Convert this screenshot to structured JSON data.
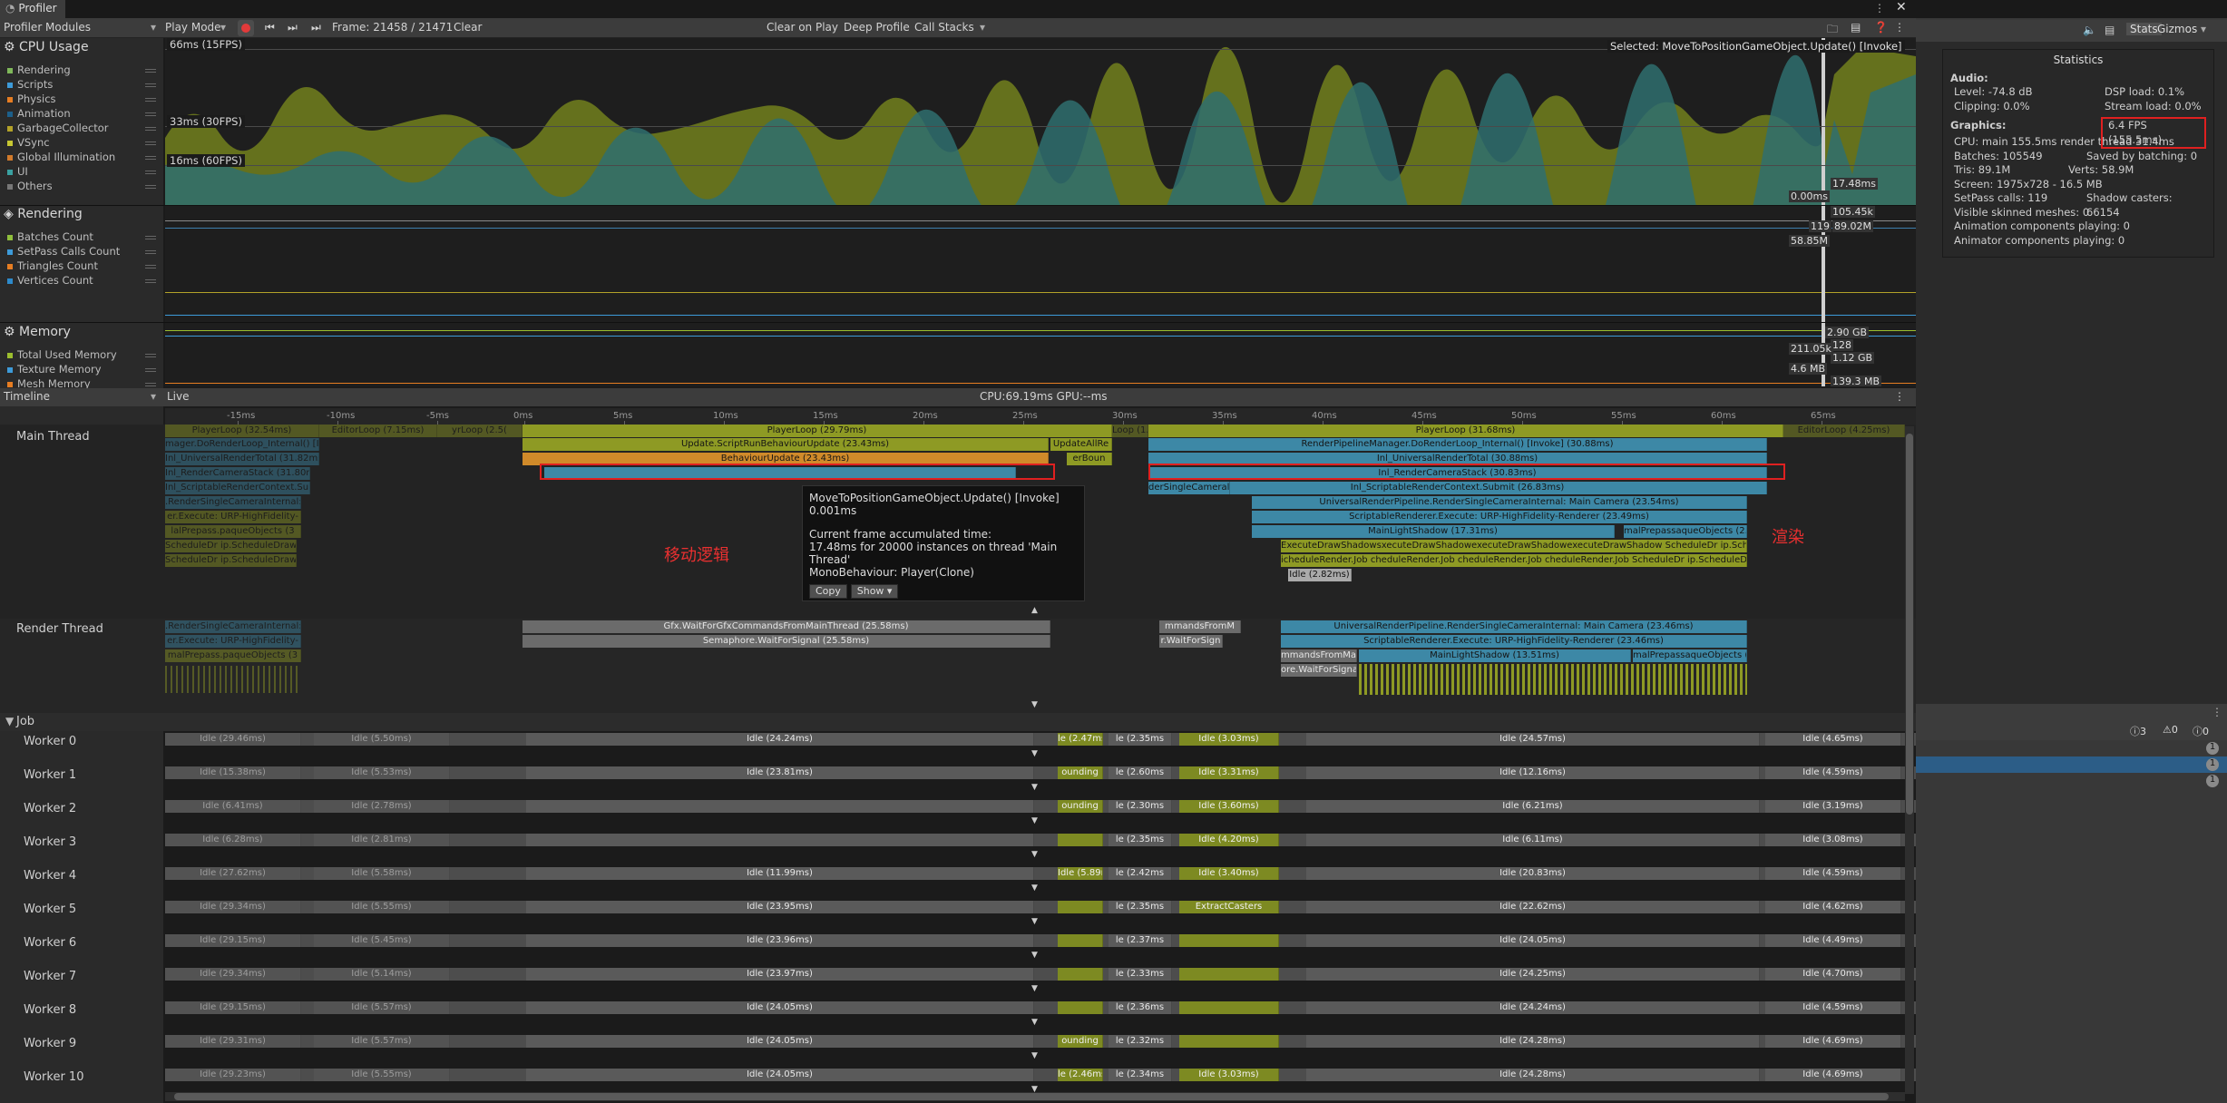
{
  "window": {
    "title": "Profiler"
  },
  "toolbar": {
    "modules": "Profiler Modules",
    "play_mode": "Play Mode",
    "frame": "Frame: 21458 / 21471",
    "clear": "Clear",
    "clear_on_play": "Clear on Play",
    "deep_profile": "Deep Profile",
    "call_stacks": "Call Stacks",
    "selected": "Selected: MoveToPositionGameObject.Update() [Invoke]"
  },
  "cpu": {
    "title": "CPU Usage",
    "items": [
      "Rendering",
      "Scripts",
      "Physics",
      "Animation",
      "GarbageCollector",
      "VSync",
      "Global Illumination",
      "UI",
      "Others"
    ],
    "colors": [
      "#7fb85a",
      "#3d9bd9",
      "#e67d22",
      "#1c5f8a",
      "#b3a229",
      "#c7c732",
      "#d17a2b",
      "#3aa1a1",
      "#777777"
    ],
    "fps": [
      "66ms (15FPS)",
      "33ms (30FPS)",
      "16ms (60FPS)"
    ]
  },
  "rendering": {
    "title": "Rendering",
    "items": [
      "Batches Count",
      "SetPass Calls Count",
      "Triangles Count",
      "Vertices Count"
    ],
    "colors": [
      "#8fbf3c",
      "#3d9bd9",
      "#e67d22",
      "#2d8acb"
    ]
  },
  "memory": {
    "title": "Memory",
    "items": [
      "Total Used Memory",
      "Texture Memory",
      "Mesh Memory"
    ],
    "colors": [
      "#9cbe2f",
      "#3d9bd9",
      "#e67d22"
    ]
  },
  "chart_labels": {
    "a": "0.00ms",
    "b": "17.48ms",
    "c": "105.45k",
    "d": "119",
    "e": "89.02M",
    "f": "58.85M",
    "g": "2.90 GB",
    "h": "128",
    "i": "211.05k",
    "j": "1.12 GB",
    "k": "4.6 MB",
    "l": "139.3 MB"
  },
  "timeline": {
    "label": "Timeline",
    "live": "Live",
    "cpu_gpu": "CPU:69.19ms  GPU:--ms",
    "ticks": [
      "-15ms",
      "-10ms",
      "-5ms",
      "0ms",
      "5ms",
      "10ms",
      "15ms",
      "20ms",
      "25ms",
      "30ms",
      "35ms",
      "40ms",
      "45ms",
      "50ms",
      "55ms",
      "60ms",
      "65ms"
    ]
  },
  "main_thread": {
    "label": "Main Thread",
    "bars": {
      "pl_left": "PlayerLoop (32.54ms)",
      "el_left": "EditorLoop (7.15ms)",
      "pl_left2": "yrLoop (2.5(",
      "r1": "mager.DoRenderLoop_Internal() [I",
      "r2": "Inl_UniversalRenderTotal (31.82ms",
      "r3": "Inl_RenderCameraStack (31.80ms)",
      "r4": "Inl_ScriptableRenderContext.Submit (28.",
      "r5": ".RenderSingleCameraInternal: M",
      "r6": "er.Execute: URP-HighFidelity-",
      "r7": "lalPrepass.paqueObjects (3",
      "r8": "ScheduleDr ip.ScheduleDraw",
      "r9": "ScheduleDr ip.ScheduleDraw",
      "pl": "PlayerLoop (29.79ms)",
      "upd": "Update.ScriptRunBehaviourUpdate (23.43ms)",
      "bu": "BehaviourUpdate (23.43ms)",
      "upd2": "UpdateAllRe",
      "eb": "erBoun",
      "lp": "Loop (1.6",
      "pl2": "PlayerLoop (31.68ms)",
      "el2": "EditorLoop (4.25ms)",
      "rpm": "RenderPipelineManager.DoRenderLoop_Internal() [Invoke] (30.88ms)",
      "urt": "Inl_UniversalRenderTotal (30.88ms)",
      "rcs": "Inl_RenderCameraStack (30.83ms)",
      "src": "Inl_ScriptableRenderContext.Submit (26.83ms)",
      "dsc": "derSingleCameral",
      "upi": "UniversalRenderPipeline.RenderSingleCameraInternal: Main Camera (23.54ms)",
      "sre": "ScriptableRenderer.Execute: URP-HighFidelity-Renderer (23.49ms)",
      "mls": "MainLightShadow (17.31ms)",
      "mpo": "malPrepassaqueObjects (2.",
      "eds": "ExecuteDrawShadowsxecuteDrawShadowexecuteDrawShadowexecuteDrawShadow ScheduleDr ip.ScheduleDraw",
      "scr": "icheduleRender.Job cheduleRender.Job cheduleRender.Job cheduleRender.Job ScheduleDr ip.ScheduleDraw",
      "idle": "Idle (2.82ms)"
    }
  },
  "tooltip": {
    "title": "MoveToPositionGameObject.Update() [Invoke]",
    "time": "0.001ms",
    "l1": "Current frame accumulated time:",
    "l2": "17.48ms for 20000 instances on thread 'Main Thread'",
    "l3": "MonoBehaviour: Player(Clone)",
    "copy": "Copy",
    "show": "Show"
  },
  "annotations": {
    "move": "移动逻辑",
    "render": "渲染"
  },
  "render_thread": {
    "label": "Render Thread",
    "bars": {
      "a": ".RenderSingleCameraInternal: 1",
      "b": "er.Execute: URP-HighFidelity-",
      "c": "malPrepass.paqueObjects (3",
      "wait": "Gfx.WaitForGfxCommandsFromMainThread (25.58ms)",
      "sem": "Semaphore.WaitForSignal (25.58ms)",
      "mf": "mmandsFromM",
      "wfs": "r.WaitForSign",
      "upi": "UniversalRenderPipeline.RenderSingleCameraInternal: Main Camera (23.46ms)",
      "sre": "ScriptableRenderer.Execute: URP-HighFidelity-Renderer (23.46ms)",
      "mls": "MainLightShadow (13.51ms)",
      "mpo": "malPrepassaqueObjects (2",
      "mf2": "mmandsFromMai",
      "wfs2": "ore.WaitForSignal"
    }
  },
  "job": {
    "label": "Job",
    "workers": [
      {
        "name": "Worker 0",
        "l1": "Idle (29.46ms)",
        "l2": "Idle (5.50ms)",
        "a": "Idle (24.24ms)",
        "b": "le (2.47ms",
        "c": "le (2.35ms",
        "d": "Idle (3.03ms)",
        "e": "Idle (24.57ms)",
        "f": "Idle (4.65ms)"
      },
      {
        "name": "Worker 1",
        "l1": "Idle (15.38ms)",
        "l2": "Idle (5.53ms)",
        "a": "Idle (23.81ms)",
        "b": "ounding",
        "c": "le (2.60ms",
        "d": "Idle (3.31ms)",
        "e": "Idle (12.16ms)",
        "f": "Idle (4.59ms)"
      },
      {
        "name": "Worker 2",
        "l1": "Idle (6.41ms)",
        "l2": "Idle (2.78ms)",
        "a": "",
        "b": "ounding",
        "c": "le (2.30ms",
        "d": "Idle (3.60ms)",
        "e": "Idle (6.21ms)",
        "f": "Idle (3.19ms)"
      },
      {
        "name": "Worker 3",
        "l1": "Idle (6.28ms)",
        "l2": "Idle (2.81ms)",
        "a": "",
        "b": "",
        "c": "le (2.35ms",
        "d": "Idle (4.20ms)",
        "e": "Idle (6.11ms)",
        "f": "Idle (3.08ms)"
      },
      {
        "name": "Worker 4",
        "l1": "Idle (27.62ms)",
        "l2": "Idle (5.58ms)",
        "a": "Idle (11.99ms)",
        "b": "Idle (5.89ms)",
        "c": "le (2.42ms",
        "d": "Idle (3.40ms)",
        "e": "Idle (20.83ms)",
        "f": "Idle (4.59ms)"
      },
      {
        "name": "Worker 5",
        "l1": "Idle (29.34ms)",
        "l2": "Idle (5.55ms)",
        "a": "Idle (23.95ms)",
        "b": "",
        "c": "le (2.35ms",
        "d": "ExtractCasters",
        "e": "Idle (22.62ms)",
        "f": "Idle (4.62ms)"
      },
      {
        "name": "Worker 6",
        "l1": "Idle (29.15ms)",
        "l2": "Idle (5.45ms)",
        "a": "Idle (23.96ms)",
        "b": "",
        "c": "le (2.37ms",
        "d": "",
        "e": "Idle (24.05ms)",
        "f": "Idle (4.49ms)"
      },
      {
        "name": "Worker 7",
        "l1": "Idle (29.34ms)",
        "l2": "Idle (5.14ms)",
        "a": "Idle (23.97ms)",
        "b": "",
        "c": "le (2.33ms",
        "d": "",
        "e": "Idle (24.25ms)",
        "f": "Idle (4.70ms)"
      },
      {
        "name": "Worker 8",
        "l1": "Idle (29.15ms)",
        "l2": "Idle (5.57ms)",
        "a": "Idle (24.05ms)",
        "b": "",
        "c": "le (2.36ms",
        "d": "",
        "e": "Idle (24.24ms)",
        "f": "Idle (4.59ms)"
      },
      {
        "name": "Worker 9",
        "l1": "Idle (29.31ms)",
        "l2": "Idle (5.57ms)",
        "a": "Idle (24.05ms)",
        "b": "ounding",
        "c": "le (2.32ms",
        "d": "",
        "e": "Idle (24.28ms)",
        "f": "Idle (4.69ms)"
      },
      {
        "name": "Worker 10",
        "l1": "Idle (29.23ms)",
        "l2": "Idle (5.55ms)",
        "a": "Idle (24.05ms)",
        "b": "le (2.46ms",
        "c": "le (2.34ms",
        "d": "Idle (3.03ms)",
        "e": "Idle (24.28ms)",
        "f": "Idle (4.69ms)"
      }
    ]
  },
  "right": {
    "stats_tab": "Stats",
    "gizmos_tab": "Gizmos",
    "console_counts": [
      "3",
      "0",
      "0"
    ],
    "badges": [
      "1",
      "1",
      "1"
    ]
  },
  "statistics": {
    "title": "Statistics",
    "audio": "Audio:",
    "level": "Level: -74.8 dB",
    "dsp": "DSP load: 0.1%",
    "clipping": "Clipping: 0.0%",
    "stream": "Stream load: 0.0%",
    "graphics": "Graphics:",
    "fps": "6.4 FPS (155.5ms)",
    "cpu": "CPU: main 155.5ms  render thread 31.4ms",
    "batches": "Batches: 105549",
    "saved": "Saved by batching: 0",
    "tris": "Tris: 89.1M",
    "verts": "Verts: 58.9M",
    "screen": "Screen: 1975x728 - 16.5 MB",
    "setpass": "SetPass calls: 119",
    "shadow": "Shadow casters: 66154",
    "skinned": "Visible skinned meshes: 0",
    "anim": "Animation components playing: 0",
    "animator": "Animator components playing: 0"
  }
}
